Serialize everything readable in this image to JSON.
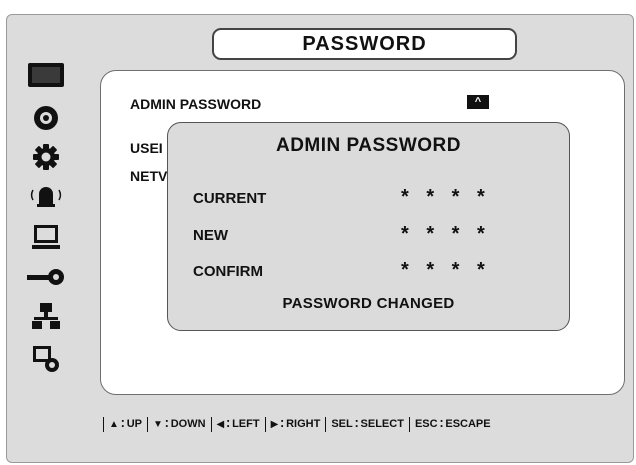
{
  "title": "PASSWORD",
  "menu": {
    "admin_password": "ADMIN PASSWORD",
    "user_password_partial": "USEI",
    "network_password_partial": "NETV",
    "toggle_symbol": "^"
  },
  "dialog": {
    "title": "ADMIN PASSWORD",
    "fields": [
      {
        "label": "CURRENT",
        "value": "* * * *"
      },
      {
        "label": "NEW",
        "value": "* * * *"
      },
      {
        "label": "CONFIRM",
        "value": "* * * *"
      }
    ],
    "status": "PASSWORD CHANGED"
  },
  "sidebar": {
    "icons": [
      "display-icon",
      "disc-icon",
      "gear-icon",
      "alarm-icon",
      "monitor-icon",
      "key-icon",
      "network-icon",
      "system-icon"
    ]
  },
  "help_bar": [
    {
      "key": "▲",
      "action": "UP"
    },
    {
      "key": "▼",
      "action": "DOWN"
    },
    {
      "key": "◀",
      "action": "LEFT"
    },
    {
      "key": "▶",
      "action": "RIGHT"
    },
    {
      "key": "SEL",
      "action": "SELECT"
    },
    {
      "key": "ESC",
      "action": "ESCAPE"
    }
  ]
}
